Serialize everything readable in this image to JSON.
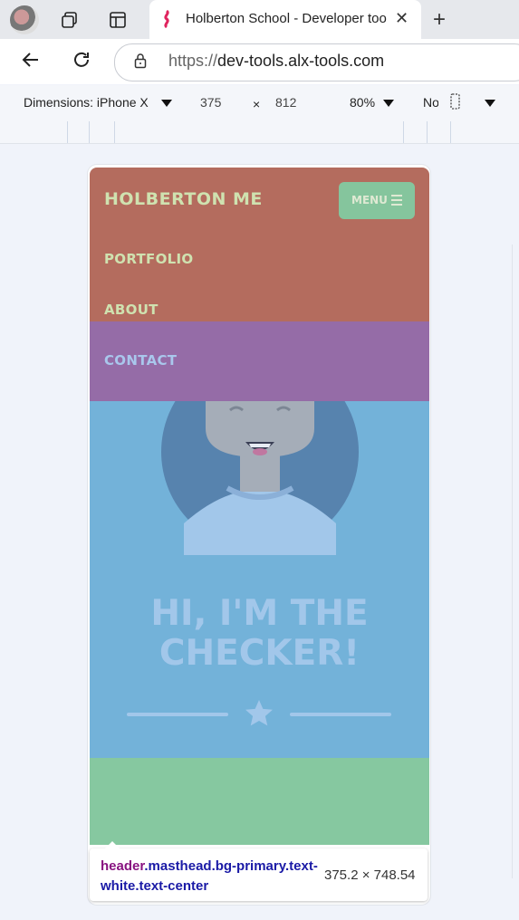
{
  "browser": {
    "tab_title": "Holberton School - Developer tools",
    "url_protocol": "https://",
    "url_host": "dev-tools.alx-tools.com"
  },
  "devtools": {
    "dimensions_label": "Dimensions: iPhone X",
    "width": "375",
    "times": "×",
    "height": "812",
    "zoom": "80%",
    "throttle": "No throttling"
  },
  "page": {
    "brand": "HOLBERTON ME",
    "menu_label": "MENU",
    "nav": [
      "PORTFOLIO",
      "ABOUT",
      "CONTACT"
    ],
    "hero_title_line1": "HI, I'M THE",
    "hero_title_line2": "CHECKER!"
  },
  "inspector_tooltip": {
    "tag": "header",
    "classes": ".masthead.bg-primary.text-white.text-center",
    "size": "375.2 × 748.54"
  },
  "colors": {
    "nav_bg": "#b46c5e",
    "contact_highlight": "#956ca7",
    "masthead_bg": "#73b2d9",
    "menu_button": "#85c59d",
    "section_green": "#86c8a0"
  }
}
